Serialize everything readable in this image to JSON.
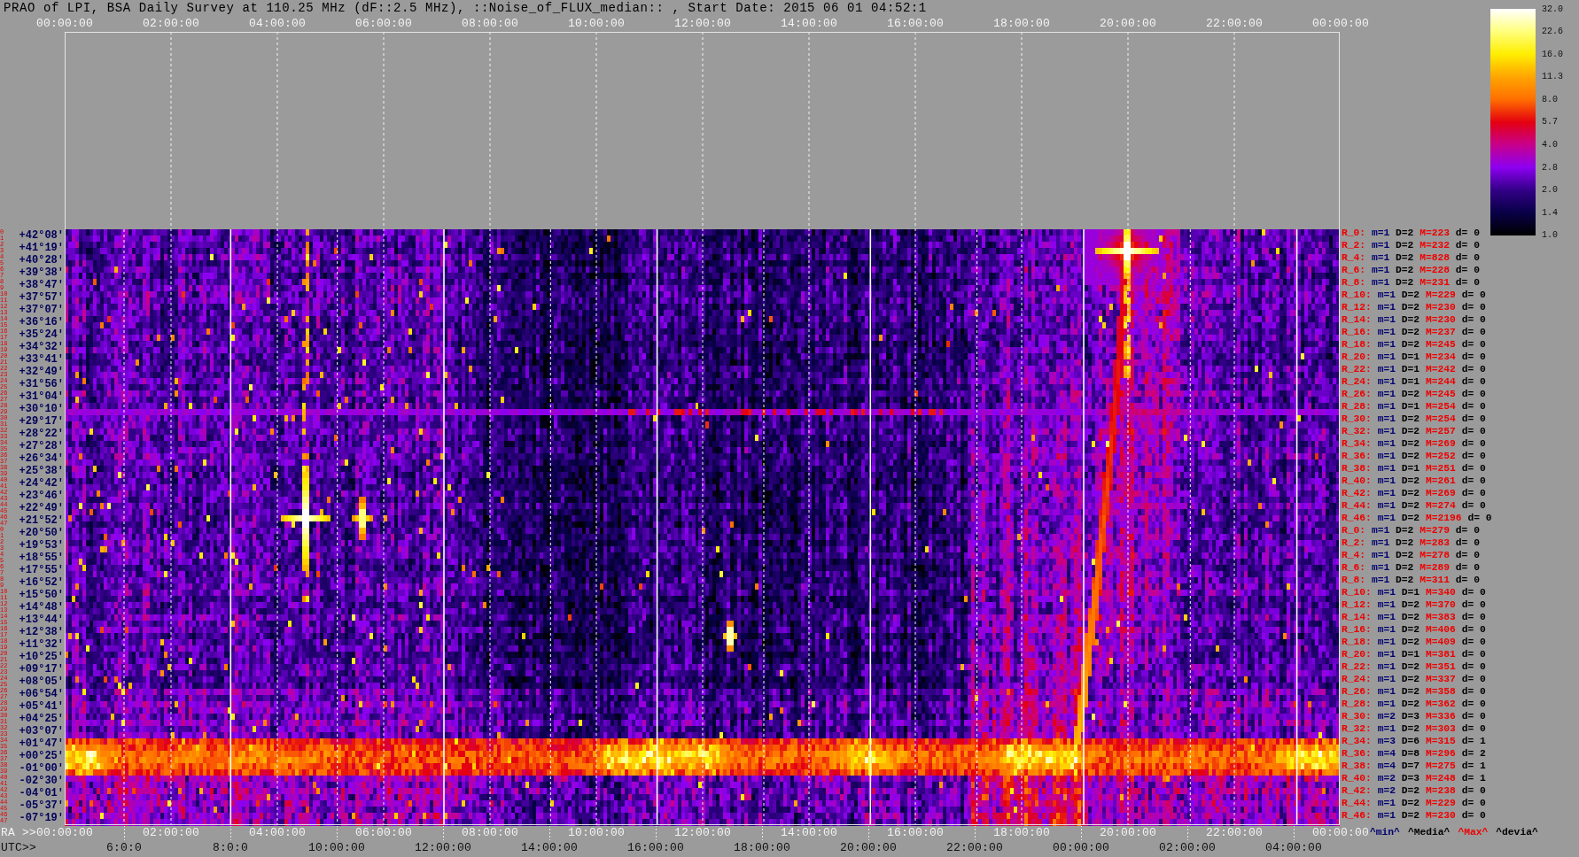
{
  "title": "PRAO of LPI, BSA Daily Survey at 110.25 MHz (dF::2.5 MHz), ::Noise_of_FLUX_median:: , Start Date: 2015 06 01 04:52:1",
  "top_axis": {
    "ticks": [
      "00:00:00",
      "02:00:00",
      "04:00:00",
      "06:00:00",
      "08:00:00",
      "10:00:00",
      "12:00:00",
      "14:00:00",
      "16:00:00",
      "18:00:00",
      "20:00:00",
      "22:00:00",
      "00:00:00"
    ]
  },
  "heatmap": {
    "row_numbers": [
      "0",
      "1",
      "2",
      "3",
      "4",
      "5",
      "6",
      "7",
      "8",
      "9",
      "10",
      "11",
      "12",
      "13",
      "14",
      "15",
      "16",
      "17",
      "18",
      "19",
      "20",
      "21",
      "22",
      "23",
      "24",
      "25",
      "26",
      "27",
      "28",
      "29",
      "30",
      "31",
      "32",
      "33",
      "34",
      "35",
      "36",
      "37",
      "38",
      "39",
      "40",
      "41",
      "42",
      "43",
      "44",
      "45",
      "46",
      "47",
      "0",
      "1",
      "2",
      "3",
      "4",
      "5",
      "6",
      "7",
      "8",
      "9",
      "10",
      "11",
      "12",
      "13",
      "14",
      "15",
      "16",
      "17",
      "18",
      "19",
      "20",
      "21",
      "22",
      "23",
      "24",
      "25",
      "26",
      "27",
      "28",
      "29",
      "30",
      "31",
      "32",
      "33",
      "34",
      "35",
      "36",
      "37",
      "38",
      "39",
      "40",
      "41",
      "42",
      "43",
      "44",
      "45",
      "46",
      "47"
    ],
    "declinations": [
      "+42°08'",
      "+41°19'",
      "+40°28'",
      "+39°38'",
      "+38°47'",
      "+37°57'",
      "+37°07'",
      "+36°16'",
      "+35°24'",
      "+34°32'",
      "+33°41'",
      "+32°49'",
      "+31°56'",
      "+31°04'",
      "+30°10'",
      "+29°17'",
      "+28°22'",
      "+27°28'",
      "+26°34'",
      "+25°38'",
      "+24°42'",
      "+23°46'",
      "+22°49'",
      "+21°52'",
      "+20°50'",
      "+19°53'",
      "+18°55'",
      "+17°55'",
      "+16°52'",
      "+15°50'",
      "+14°48'",
      "+13°44'",
      "+12°38'",
      "+11°32'",
      "+10°25'",
      "+09°17'",
      "+08°05'",
      "+06°54'",
      "+05°41'",
      "+04°25'",
      "+03°07'",
      "+01°47'",
      "+00°25'",
      "-01°00'",
      "-02°30'",
      "-04°01'",
      "-05°37'",
      "-07°19'"
    ]
  },
  "beam_stats": [
    {
      "beam": "R_0:",
      "values": [
        "m=1",
        "D=2",
        "M=223",
        "d= 0"
      ]
    },
    {
      "beam": "R_2:",
      "values": [
        "m=1",
        "D=2",
        "M=232",
        "d= 0"
      ]
    },
    {
      "beam": "R_4:",
      "values": [
        "m=1",
        "D=2",
        "M=828",
        "d= 0"
      ]
    },
    {
      "beam": "R_6:",
      "values": [
        "m=1",
        "D=2",
        "M=228",
        "d= 0"
      ]
    },
    {
      "beam": "R_8:",
      "values": [
        "m=1",
        "D=2",
        "M=231",
        "d= 0"
      ]
    },
    {
      "beam": "R_10:",
      "values": [
        "m=1",
        "D=2",
        "M=229",
        "d= 0"
      ]
    },
    {
      "beam": "R_12:",
      "values": [
        "m=1",
        "D=2",
        "M=230",
        "d= 0"
      ]
    },
    {
      "beam": "R_14:",
      "values": [
        "m=1",
        "D=2",
        "M=230",
        "d= 0"
      ]
    },
    {
      "beam": "R_16:",
      "values": [
        "m=1",
        "D=2",
        "M=237",
        "d= 0"
      ]
    },
    {
      "beam": "R_18:",
      "values": [
        "m=1",
        "D=2",
        "M=245",
        "d= 0"
      ]
    },
    {
      "beam": "R_20:",
      "values": [
        "m=1",
        "D=1",
        "M=234",
        "d= 0"
      ]
    },
    {
      "beam": "R_22:",
      "values": [
        "m=1",
        "D=1",
        "M=242",
        "d= 0"
      ]
    },
    {
      "beam": "R_24:",
      "values": [
        "m=1",
        "D=1",
        "M=244",
        "d= 0"
      ]
    },
    {
      "beam": "R_26:",
      "values": [
        "m=1",
        "D=2",
        "M=245",
        "d= 0"
      ]
    },
    {
      "beam": "R_28:",
      "values": [
        "m=1",
        "D=1",
        "M=254",
        "d= 0"
      ]
    },
    {
      "beam": "R_30:",
      "values": [
        "m=1",
        "D=2",
        "M=254",
        "d= 0"
      ]
    },
    {
      "beam": "R_32:",
      "values": [
        "m=1",
        "D=2",
        "M=257",
        "d= 0"
      ]
    },
    {
      "beam": "R_34:",
      "values": [
        "m=1",
        "D=2",
        "M=269",
        "d= 0"
      ]
    },
    {
      "beam": "R_36:",
      "values": [
        "m=1",
        "D=2",
        "M=252",
        "d= 0"
      ]
    },
    {
      "beam": "R_38:",
      "values": [
        "m=1",
        "D=1",
        "M=251",
        "d= 0"
      ]
    },
    {
      "beam": "R_40:",
      "values": [
        "m=1",
        "D=2",
        "M=261",
        "d= 0"
      ]
    },
    {
      "beam": "R_42:",
      "values": [
        "m=1",
        "D=2",
        "M=269",
        "d= 0"
      ]
    },
    {
      "beam": "R_44:",
      "values": [
        "m=1",
        "D=2",
        "M=274",
        "d= 0"
      ]
    },
    {
      "beam": "R_46:",
      "values": [
        "m=1",
        "D=2",
        "M=2196",
        "d= 0"
      ]
    },
    {
      "beam": "R_0:",
      "values": [
        "m=1",
        "D=2",
        "M=279",
        "d= 0"
      ]
    },
    {
      "beam": "R_2:",
      "values": [
        "m=1",
        "D=2",
        "M=283",
        "d= 0"
      ]
    },
    {
      "beam": "R_4:",
      "values": [
        "m=1",
        "D=2",
        "M=278",
        "d= 0"
      ]
    },
    {
      "beam": "R_6:",
      "values": [
        "m=1",
        "D=2",
        "M=289",
        "d= 0"
      ]
    },
    {
      "beam": "R_8:",
      "values": [
        "m=1",
        "D=2",
        "M=311",
        "d= 0"
      ]
    },
    {
      "beam": "R_10:",
      "values": [
        "m=1",
        "D=1",
        "M=340",
        "d= 0"
      ]
    },
    {
      "beam": "R_12:",
      "values": [
        "m=1",
        "D=2",
        "M=370",
        "d= 0"
      ]
    },
    {
      "beam": "R_14:",
      "values": [
        "m=1",
        "D=2",
        "M=383",
        "d= 0"
      ]
    },
    {
      "beam": "R_16:",
      "values": [
        "m=1",
        "D=2",
        "M=406",
        "d= 0"
      ]
    },
    {
      "beam": "R_18:",
      "values": [
        "m=1",
        "D=2",
        "M=409",
        "d= 0"
      ]
    },
    {
      "beam": "R_20:",
      "values": [
        "m=1",
        "D=1",
        "M=381",
        "d= 0"
      ]
    },
    {
      "beam": "R_22:",
      "values": [
        "m=1",
        "D=2",
        "M=351",
        "d= 0"
      ]
    },
    {
      "beam": "R_24:",
      "values": [
        "m=1",
        "D=2",
        "M=337",
        "d= 0"
      ]
    },
    {
      "beam": "R_26:",
      "values": [
        "m=1",
        "D=2",
        "M=358",
        "d= 0"
      ]
    },
    {
      "beam": "R_28:",
      "values": [
        "m=1",
        "D=2",
        "M=362",
        "d= 0"
      ]
    },
    {
      "beam": "R_30:",
      "values": [
        "m=2",
        "D=3",
        "M=336",
        "d= 0"
      ]
    },
    {
      "beam": "R_32:",
      "values": [
        "m=1",
        "D=2",
        "M=303",
        "d= 0"
      ]
    },
    {
      "beam": "R_34:",
      "values": [
        "m=3",
        "D=6",
        "M=315",
        "d= 1"
      ]
    },
    {
      "beam": "R_36:",
      "values": [
        "m=4",
        "D=8",
        "M=296",
        "d= 2"
      ]
    },
    {
      "beam": "R_38:",
      "values": [
        "m=4",
        "D=7",
        "M=275",
        "d= 1"
      ]
    },
    {
      "beam": "R_40:",
      "values": [
        "m=2",
        "D=3",
        "M=248",
        "d= 1"
      ]
    },
    {
      "beam": "R_42:",
      "values": [
        "m=2",
        "D=2",
        "M=238",
        "d= 0"
      ]
    },
    {
      "beam": "R_44:",
      "values": [
        "m=1",
        "D=2",
        "M=229",
        "d= 0"
      ]
    },
    {
      "beam": "R_46:",
      "values": [
        "m=1",
        "D=2",
        "M=230",
        "d= 0"
      ]
    }
  ],
  "color_scale": {
    "ticks": [
      "32.0",
      "22.6",
      "16.0",
      "11.3",
      "8.0",
      "5.7",
      "4.0",
      "2.8",
      "2.0",
      "1.4",
      "1.0"
    ]
  },
  "bottom_axis": {
    "ra_prefix": "RA >>",
    "ra_ticks": [
      "00:00:00",
      "02:00:00",
      "04:00:00",
      "06:00:00",
      "08:00:00",
      "10:00:00",
      "12:00:00",
      "14:00:00",
      "16:00:00",
      "18:00:00",
      "20:00:00",
      "22:00:00",
      "00:00:00"
    ],
    "utc_prefix": "UTC>>",
    "utc_ticks": [
      "6:0:0",
      "8:0:0",
      "10:00:00",
      "12:00:00",
      "14:00:00",
      "16:00:00",
      "18:00:00",
      "20:00:00",
      "22:00:00",
      "00:00:00",
      "02:00:00",
      "04:00:00"
    ]
  },
  "legend": [
    {
      "label": "^min^",
      "color": "#000070"
    },
    {
      "label": "^Media^",
      "color": "#000000"
    },
    {
      "label": "^Max^",
      "color": "#ee0000"
    },
    {
      "label": "^devia^",
      "color": "#000000"
    }
  ]
}
